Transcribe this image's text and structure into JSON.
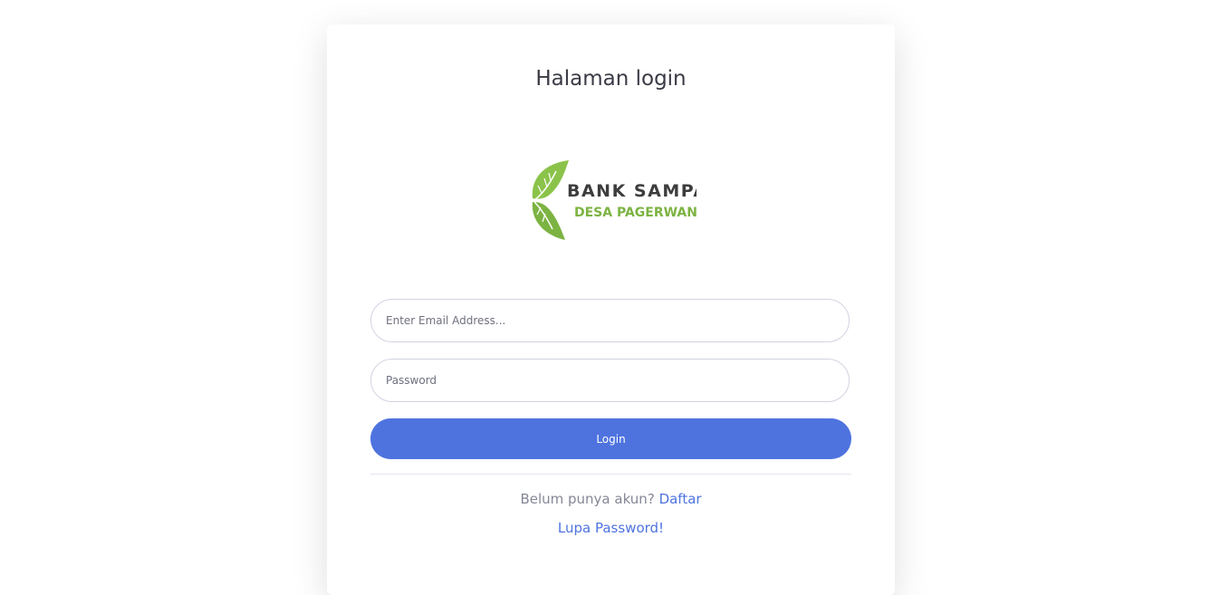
{
  "page": {
    "title": "Halaman login"
  },
  "logo": {
    "line1": "BANK SAMPAH",
    "line2": "DESA PAGERWANGI",
    "icon": "leaf-icon",
    "colors": {
      "leaf": "#8bc34a",
      "leaf_dark": "#6a9e3a",
      "text_dark": "#3d3d3d",
      "text_green": "#7cb342"
    }
  },
  "form": {
    "email_placeholder": "Enter Email Address...",
    "password_placeholder": "Password",
    "login_label": "Login"
  },
  "footer": {
    "register_prompt": "Belum punya akun?",
    "register_link": "Daftar",
    "forgot_link": "Lupa Password!"
  },
  "colors": {
    "primary": "#4e73df",
    "muted_text": "#858796",
    "border": "#d1d3e2"
  }
}
